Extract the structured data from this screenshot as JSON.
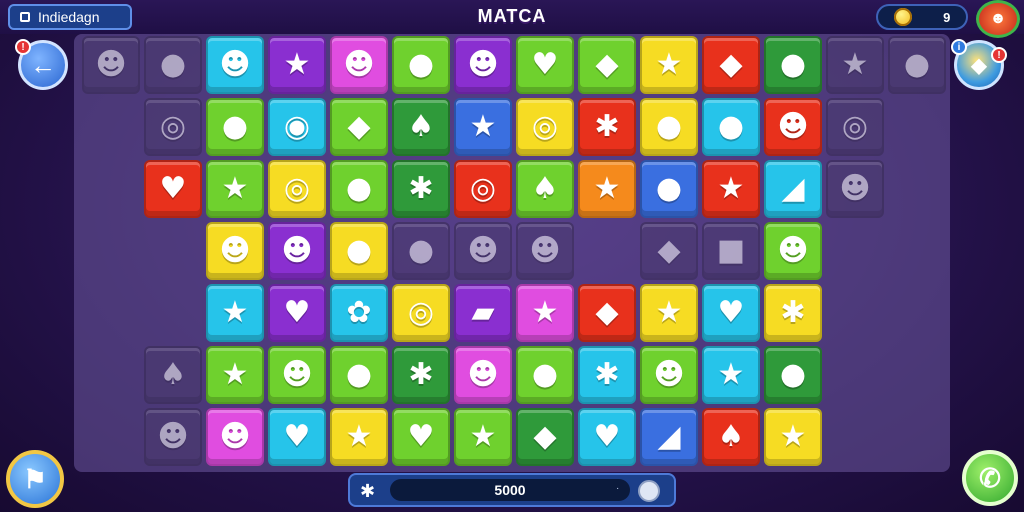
{
  "header": {
    "app_name": "Indiedagn",
    "title": "MATCA",
    "coins": "9"
  },
  "footer": {
    "score": "5000"
  },
  "colors": {
    "yellow": "#f6dc23",
    "cyan": "#26c4ea",
    "purple": "#8a2fd0",
    "pink": "#e04de0",
    "green": "#6fd12e",
    "red": "#e8311c",
    "orange": "#f58a1c",
    "blue": "#3a6fe0",
    "darkgreen": "#2f9a3a",
    "dim": "#4a3a6e"
  },
  "board": {
    "rows": [
      [
        {
          "color": "dim",
          "icon": "face-icon",
          "glyph": "☻"
        },
        {
          "color": "dim",
          "icon": "orb-icon",
          "glyph": "●"
        },
        {
          "color": "cyan",
          "icon": "face-icon",
          "glyph": "☻"
        },
        {
          "color": "purple",
          "icon": "star-icon",
          "glyph": "★"
        },
        {
          "color": "pink",
          "icon": "face-icon",
          "glyph": "☻"
        },
        {
          "color": "green",
          "icon": "berry-icon",
          "glyph": "●"
        },
        {
          "color": "purple",
          "icon": "face-icon",
          "glyph": "☻"
        },
        {
          "color": "green",
          "icon": "heart-icon",
          "glyph": "♥"
        },
        {
          "color": "green",
          "icon": "carrot-icon",
          "glyph": "◆"
        },
        {
          "color": "yellow",
          "icon": "star-icon",
          "glyph": "★"
        },
        {
          "color": "red",
          "icon": "carrot-icon",
          "glyph": "◆"
        },
        {
          "color": "darkgreen",
          "icon": "lemon-icon",
          "glyph": "●"
        },
        {
          "color": "dim",
          "icon": "star-icon",
          "glyph": "★"
        },
        {
          "color": "dim",
          "icon": "berry-icon",
          "glyph": "●"
        }
      ],
      [
        null,
        {
          "color": "dim",
          "icon": "swirl-icon",
          "glyph": "◎"
        },
        {
          "color": "green",
          "icon": "lemon-icon",
          "glyph": "●"
        },
        {
          "color": "cyan",
          "icon": "candy-icon",
          "glyph": "◉"
        },
        {
          "color": "green",
          "icon": "popsicle-icon",
          "glyph": "◆"
        },
        {
          "color": "darkgreen",
          "icon": "leaf-icon",
          "glyph": "♠"
        },
        {
          "color": "blue",
          "icon": "star-icon",
          "glyph": "★"
        },
        {
          "color": "yellow",
          "icon": "coin-icon",
          "glyph": "◎"
        },
        {
          "color": "red",
          "icon": "splat-icon",
          "glyph": "✱"
        },
        {
          "color": "yellow",
          "icon": "blueberry-icon",
          "glyph": "●"
        },
        {
          "color": "cyan",
          "icon": "orb-icon",
          "glyph": "●"
        },
        {
          "color": "red",
          "icon": "face-icon",
          "glyph": "☻"
        },
        {
          "color": "dim",
          "icon": "swirl-icon",
          "glyph": "◎"
        },
        null
      ],
      [
        null,
        {
          "color": "red",
          "icon": "heart-icon",
          "glyph": "♥"
        },
        {
          "color": "green",
          "icon": "star-icon",
          "glyph": "★"
        },
        {
          "color": "yellow",
          "icon": "swirl-icon",
          "glyph": "◎"
        },
        {
          "color": "green",
          "icon": "apple-icon",
          "glyph": "●"
        },
        {
          "color": "darkgreen",
          "icon": "splat-icon",
          "glyph": "✱"
        },
        {
          "color": "red",
          "icon": "swirl-icon",
          "glyph": "◎"
        },
        {
          "color": "green",
          "icon": "leaf-icon",
          "glyph": "♠"
        },
        {
          "color": "orange",
          "icon": "star-icon",
          "glyph": "★"
        },
        {
          "color": "blue",
          "icon": "lemon-icon",
          "glyph": "●"
        },
        {
          "color": "red",
          "icon": "star-icon",
          "glyph": "★"
        },
        {
          "color": "cyan",
          "icon": "cheese-icon",
          "glyph": "◢"
        },
        {
          "color": "dim",
          "icon": "face-icon",
          "glyph": "☻"
        },
        null
      ],
      [
        null,
        null,
        {
          "color": "yellow",
          "icon": "face-icon",
          "glyph": "☻"
        },
        {
          "color": "purple",
          "icon": "face-icon",
          "glyph": "☻"
        },
        {
          "color": "yellow",
          "icon": "orb-icon",
          "glyph": "●"
        },
        {
          "color": "dim",
          "icon": "berry-icon",
          "glyph": "●"
        },
        {
          "color": "dim",
          "icon": "face-icon",
          "glyph": "☻"
        },
        {
          "color": "dim",
          "icon": "face-icon",
          "glyph": "☻"
        },
        null,
        {
          "color": "dim",
          "icon": "candy-icon",
          "glyph": "◆"
        },
        {
          "color": "dim",
          "icon": "toast-icon",
          "glyph": "■"
        },
        {
          "color": "green",
          "icon": "face-icon",
          "glyph": "☻"
        },
        null,
        null
      ],
      [
        null,
        null,
        {
          "color": "cyan",
          "icon": "star-icon",
          "glyph": "★"
        },
        {
          "color": "purple",
          "icon": "heart-icon",
          "glyph": "♥"
        },
        {
          "color": "cyan",
          "icon": "flower-icon",
          "glyph": "✿"
        },
        {
          "color": "yellow",
          "icon": "coin-icon",
          "glyph": "◎"
        },
        {
          "color": "purple",
          "icon": "crystal-icon",
          "glyph": "▰"
        },
        {
          "color": "pink",
          "icon": "star-icon",
          "glyph": "★"
        },
        {
          "color": "red",
          "icon": "popsicle-icon",
          "glyph": "◆"
        },
        {
          "color": "yellow",
          "icon": "star-icon",
          "glyph": "★"
        },
        {
          "color": "cyan",
          "icon": "heart-icon",
          "glyph": "♥"
        },
        {
          "color": "yellow",
          "icon": "splat-icon",
          "glyph": "✱"
        },
        null,
        null
      ],
      [
        null,
        {
          "color": "dim",
          "icon": "leaf-icon",
          "glyph": "♠"
        },
        {
          "color": "green",
          "icon": "star-face-icon",
          "glyph": "★"
        },
        {
          "color": "green",
          "icon": "face-icon",
          "glyph": "☻"
        },
        {
          "color": "green",
          "icon": "lemon-icon",
          "glyph": "●"
        },
        {
          "color": "darkgreen",
          "icon": "splat-icon",
          "glyph": "✱"
        },
        {
          "color": "pink",
          "icon": "face-icon",
          "glyph": "☻"
        },
        {
          "color": "green",
          "icon": "berry-icon",
          "glyph": "●"
        },
        {
          "color": "cyan",
          "icon": "splat-icon",
          "glyph": "✱"
        },
        {
          "color": "green",
          "icon": "face-icon",
          "glyph": "☻"
        },
        {
          "color": "cyan",
          "icon": "star-icon",
          "glyph": "★"
        },
        {
          "color": "darkgreen",
          "icon": "apple-icon",
          "glyph": "●"
        },
        null,
        null
      ],
      [
        null,
        {
          "color": "dim",
          "icon": "face-icon",
          "glyph": "☻"
        },
        {
          "color": "pink",
          "icon": "face-icon",
          "glyph": "☻"
        },
        {
          "color": "cyan",
          "icon": "heart-icon",
          "glyph": "♥"
        },
        {
          "color": "yellow",
          "icon": "star-icon",
          "glyph": "★"
        },
        {
          "color": "green",
          "icon": "heart-icon",
          "glyph": "♥"
        },
        {
          "color": "green",
          "icon": "star-icon",
          "glyph": "★"
        },
        {
          "color": "darkgreen",
          "icon": "candy-icon",
          "glyph": "◆"
        },
        {
          "color": "cyan",
          "icon": "heart-icon",
          "glyph": "♥"
        },
        {
          "color": "blue",
          "icon": "cheese-icon",
          "glyph": "◢"
        },
        {
          "color": "red",
          "icon": "leaf-icon",
          "glyph": "♠"
        },
        {
          "color": "yellow",
          "icon": "star-icon",
          "glyph": "★"
        },
        null,
        null
      ]
    ]
  }
}
